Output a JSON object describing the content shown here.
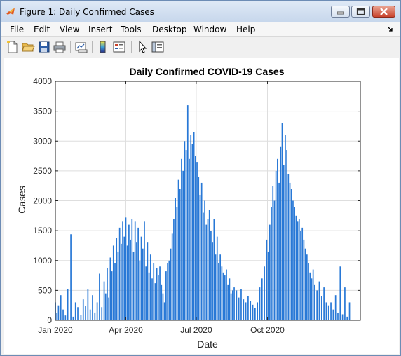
{
  "window": {
    "title": "Figure 1: Daily Confirmed Cases"
  },
  "menu": {
    "items": [
      "File",
      "Edit",
      "View",
      "Insert",
      "Tools",
      "Desktop",
      "Window",
      "Help"
    ],
    "dock_icon": "dock-arrow-icon"
  },
  "toolbar": {
    "icons": [
      "new-figure-icon",
      "open-file-icon",
      "save-icon",
      "print-icon",
      "link-plot-icon",
      "insert-colorbar-icon",
      "insert-legend-icon",
      "edit-plot-arrow-icon",
      "property-inspector-icon"
    ]
  },
  "colors": {
    "bar": "#2878d6",
    "title_bar_top": "#dfe9f6",
    "close_button": "#c9442e"
  },
  "chart_data": {
    "type": "bar",
    "title": "Daily Confirmed COVID-19 Cases",
    "xlabel": "Date",
    "ylabel": "Cases",
    "ylim": [
      0,
      4000
    ],
    "yticks": [
      0,
      500,
      1000,
      1500,
      2000,
      2500,
      3000,
      3500,
      4000
    ],
    "xlim": [
      "2020-01-01",
      "2021-01-29"
    ],
    "xticks": [
      {
        "date": "2020-01-01",
        "label": "Jan 2020"
      },
      {
        "date": "2020-04-01",
        "label": "Apr 2020"
      },
      {
        "date": "2020-07-01",
        "label": "Jul 2020"
      },
      {
        "date": "2020-10-01",
        "label": "Oct 2020"
      }
    ],
    "grid": true,
    "x": [
      "2020-01-01",
      "2020-01-03",
      "2020-01-05",
      "2020-01-08",
      "2020-01-11",
      "2020-01-14",
      "2020-01-17",
      "2020-01-21",
      "2020-01-24",
      "2020-01-27",
      "2020-01-30",
      "2020-02-03",
      "2020-02-06",
      "2020-02-09",
      "2020-02-12",
      "2020-02-15",
      "2020-02-18",
      "2020-02-21",
      "2020-02-24",
      "2020-02-27",
      "2020-03-01",
      "2020-03-04",
      "2020-03-06",
      "2020-03-08",
      "2020-03-10",
      "2020-03-12",
      "2020-03-14",
      "2020-03-16",
      "2020-03-18",
      "2020-03-20",
      "2020-03-22",
      "2020-03-24",
      "2020-03-26",
      "2020-03-28",
      "2020-03-30",
      "2020-04-01",
      "2020-04-03",
      "2020-04-05",
      "2020-04-07",
      "2020-04-09",
      "2020-04-11",
      "2020-04-13",
      "2020-04-15",
      "2020-04-17",
      "2020-04-19",
      "2020-04-21",
      "2020-04-23",
      "2020-04-25",
      "2020-04-27",
      "2020-04-29",
      "2020-05-01",
      "2020-05-03",
      "2020-05-05",
      "2020-05-07",
      "2020-05-09",
      "2020-05-11",
      "2020-05-13",
      "2020-05-15",
      "2020-05-17",
      "2020-05-19",
      "2020-05-21",
      "2020-05-23",
      "2020-05-25",
      "2020-05-27",
      "2020-05-29",
      "2020-05-31",
      "2020-06-02",
      "2020-06-04",
      "2020-06-06",
      "2020-06-08",
      "2020-06-10",
      "2020-06-12",
      "2020-06-14",
      "2020-06-16",
      "2020-06-18",
      "2020-06-20",
      "2020-06-22",
      "2020-06-24",
      "2020-06-26",
      "2020-06-28",
      "2020-06-30",
      "2020-07-02",
      "2020-07-04",
      "2020-07-06",
      "2020-07-08",
      "2020-07-10",
      "2020-07-12",
      "2020-07-14",
      "2020-07-16",
      "2020-07-18",
      "2020-07-20",
      "2020-07-22",
      "2020-07-24",
      "2020-07-26",
      "2020-07-28",
      "2020-07-30",
      "2020-08-01",
      "2020-08-03",
      "2020-08-05",
      "2020-08-07",
      "2020-08-09",
      "2020-08-11",
      "2020-08-13",
      "2020-08-15",
      "2020-08-17",
      "2020-08-19",
      "2020-08-22",
      "2020-08-25",
      "2020-08-28",
      "2020-08-31",
      "2020-09-03",
      "2020-09-06",
      "2020-09-09",
      "2020-09-12",
      "2020-09-15",
      "2020-09-18",
      "2020-09-21",
      "2020-09-24",
      "2020-09-27",
      "2020-09-30",
      "2020-10-02",
      "2020-10-04",
      "2020-10-06",
      "2020-10-08",
      "2020-10-10",
      "2020-10-12",
      "2020-10-14",
      "2020-10-16",
      "2020-10-18",
      "2020-10-20",
      "2020-10-22",
      "2020-10-24",
      "2020-10-26",
      "2020-10-28",
      "2020-10-30",
      "2020-11-01",
      "2020-11-03",
      "2020-11-05",
      "2020-11-07",
      "2020-11-09",
      "2020-11-11",
      "2020-11-13",
      "2020-11-15",
      "2020-11-17",
      "2020-11-19",
      "2020-11-21",
      "2020-11-23",
      "2020-11-25",
      "2020-11-27",
      "2020-11-29",
      "2020-12-01",
      "2020-12-04",
      "2020-12-07",
      "2020-12-10",
      "2020-12-13",
      "2020-12-16",
      "2020-12-19",
      "2020-12-22",
      "2020-12-25",
      "2020-12-28",
      "2020-12-31",
      "2021-01-03",
      "2021-01-06",
      "2021-01-09",
      "2021-01-12",
      "2021-01-15",
      "2021-01-18",
      "2021-01-21",
      "2021-01-24",
      "2021-01-27"
    ],
    "series": [
      {
        "values": [
          300,
          120,
          250,
          420,
          180,
          80,
          520,
          1440,
          60,
          300,
          220,
          90,
          350,
          240,
          520,
          180,
          420,
          130,
          300,
          780,
          220,
          650,
          450,
          880,
          380,
          1050,
          820,
          1250,
          950,
          1380,
          1150,
          1550,
          1280,
          1650,
          1400,
          1720,
          1250,
          1600,
          1350,
          1700,
          1150,
          1650,
          1300,
          1550,
          1000,
          1400,
          1200,
          1650,
          900,
          1300,
          800,
          1100,
          700,
          950,
          620,
          880,
          750,
          900,
          600,
          450,
          300,
          820,
          950,
          1000,
          1200,
          1450,
          1700,
          2050,
          1900,
          2350,
          2200,
          2700,
          2500,
          3000,
          2850,
          3600,
          2700,
          3100,
          2950,
          3150,
          2750,
          2650,
          2400,
          2100,
          2300,
          1800,
          2000,
          1600,
          1700,
          1850,
          1500,
          1300,
          1700,
          1100,
          1400,
          950,
          1100,
          900,
          800,
          750,
          850,
          600,
          700,
          450,
          500,
          550,
          500,
          380,
          520,
          350,
          300,
          400,
          320,
          260,
          210,
          300,
          550,
          700,
          900,
          1350,
          1150,
          1600,
          1900,
          2250,
          2000,
          2500,
          2700,
          2300,
          2900,
          3300,
          2600,
          3100,
          2850,
          2450,
          2300,
          2200,
          2000,
          1900,
          1750,
          1650,
          1700,
          1500,
          1550,
          1350,
          1200,
          1100,
          950,
          800,
          700,
          850,
          600,
          500,
          650,
          400,
          550,
          300,
          250,
          300,
          180,
          420,
          120,
          900,
          100,
          550,
          60,
          300
        ]
      }
    ]
  }
}
